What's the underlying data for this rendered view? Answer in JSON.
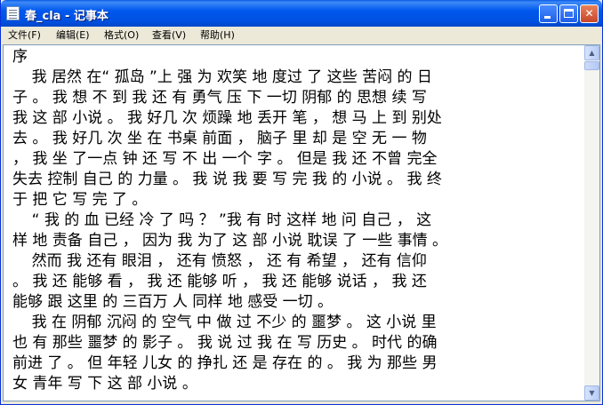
{
  "window": {
    "title": "春_cla - 记事本",
    "controls": {
      "minimize": "",
      "maximize": "",
      "close": "✕"
    }
  },
  "menu": [
    {
      "label": "文件(F)"
    },
    {
      "label": "编辑(E)"
    },
    {
      "label": "格式(O)"
    },
    {
      "label": "查看(V)"
    },
    {
      "label": "帮助(H)"
    }
  ],
  "document": {
    "lines": [
      "序",
      "    我 居然 在“ 孤岛 ”上 强 为 欢笑 地 度过 了 这些 苦闷 的 日",
      "子 。 我 想 不 到 我 还 有 勇气 压 下 一切 阴郁 的 思想 续 写",
      "我 这 部 小说 。 我 好几 次 烦躁 地 丢开 笔 ， 想 马 上 到 别处",
      "去 。 我 好几 次 坐 在 书桌 前面 ， 脑子 里 却 是 空 无 一 物",
      "， 我 坐 了一点 钟 还 写 不 出 一个 字 。 但是 我 还 不曾 完全",
      "失去 控制 自己 的 力量 。 我 说 我 要 写 完 我 的 小说 。 我 终",
      "于 把 它 写 完 了 。",
      "    “ 我 的 血 已经 冷 了 吗 ？ ”我 有 时 这样 地 问 自己 ， 这",
      "样 地 责备 自己 ， 因为 我 为了 这 部 小说 耽误 了 一些 事情 。",
      "    然而 我 还有 眼泪 ， 还有 愤怒 ， 还 有 希望 ， 还有 信仰",
      "。 我 还 能够 看 ， 我 还 能够 听 ， 我 还 能够 说话 ， 我 还",
      "能够 跟 这里 的 三百万 人 同样 地 感受 一切 。",
      "    我 在 阴郁 沉闷 的 空气 中 做 过 不少 的 噩梦 。 这 小说 里",
      "也 有 那些 噩梦 的 影子 。 我 说 过 我 在 写 历史 。 时代 的确",
      "前进 了 。 但 年轻 儿女 的 挣扎 还 是 存在 的 。 我 为 那些 男",
      "女 青年 写 下 这 部 小说 。"
    ]
  },
  "scrollbar": {
    "up_icon": "▲",
    "down_icon": "▼"
  }
}
